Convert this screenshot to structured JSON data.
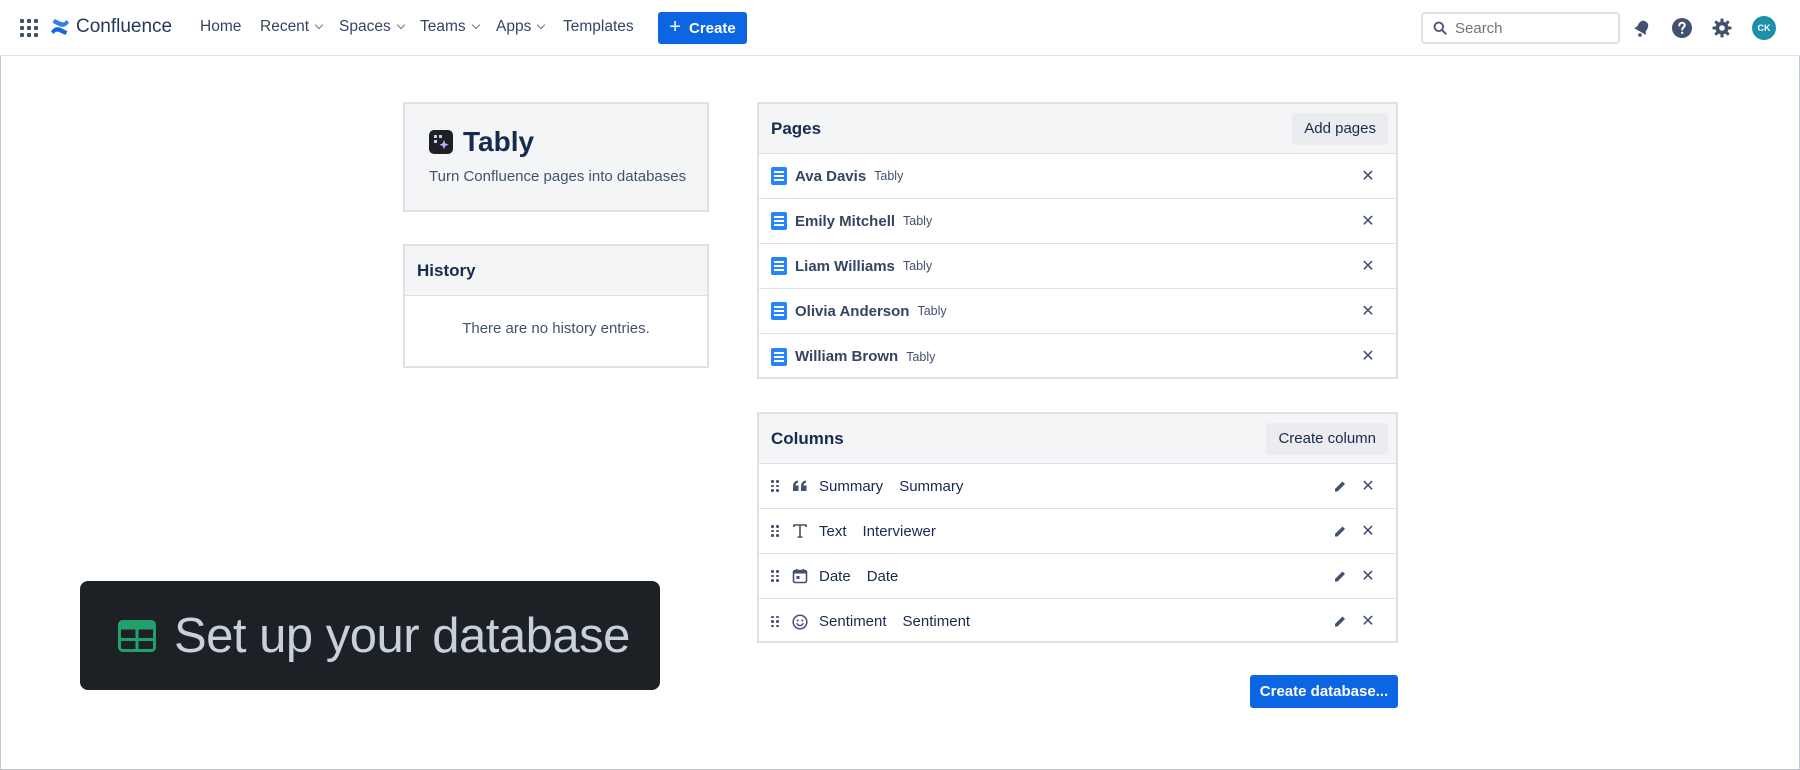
{
  "nav": {
    "product_name": "Confluence",
    "items": [
      {
        "label": "Home",
        "dropdown": false
      },
      {
        "label": "Recent",
        "dropdown": true
      },
      {
        "label": "Spaces",
        "dropdown": true
      },
      {
        "label": "Teams",
        "dropdown": true
      },
      {
        "label": "Apps",
        "dropdown": true
      },
      {
        "label": "Templates",
        "dropdown": false
      }
    ],
    "create_label": "Create",
    "search_placeholder": "Search",
    "avatar_initials": "CK",
    "icons": [
      "app-switcher-icon",
      "notifications-icon",
      "help-icon",
      "settings-icon"
    ]
  },
  "app_card": {
    "name": "Tably",
    "description": "Turn Confluence pages into databases"
  },
  "history": {
    "title": "History",
    "empty_text": "There are no history entries."
  },
  "pages": {
    "title": "Pages",
    "add_label": "Add pages",
    "items": [
      {
        "name": "Ava Davis",
        "space": "Tably"
      },
      {
        "name": "Emily Mitchell",
        "space": "Tably"
      },
      {
        "name": "Liam Williams",
        "space": "Tably"
      },
      {
        "name": "Olivia Anderson",
        "space": "Tably"
      },
      {
        "name": "William Brown",
        "space": "Tably"
      }
    ]
  },
  "columns": {
    "title": "Columns",
    "create_label": "Create column",
    "items": [
      {
        "type": "Summary",
        "name": "Summary",
        "icon": "quote-icon"
      },
      {
        "type": "Text",
        "name": "Interviewer",
        "icon": "text-type-icon"
      },
      {
        "type": "Date",
        "name": "Date",
        "icon": "calendar-icon"
      },
      {
        "type": "Sentiment",
        "name": "Sentiment",
        "icon": "smiley-icon"
      }
    ]
  },
  "create_database_label": "Create database...",
  "banner": {
    "text": "Set up your database",
    "icon": "table-icon",
    "icon_color": "#22a06b"
  },
  "colors": {
    "primary": "#0c66e4",
    "doc_icon": "#2684ff",
    "avatar": "#1d8fa8"
  }
}
